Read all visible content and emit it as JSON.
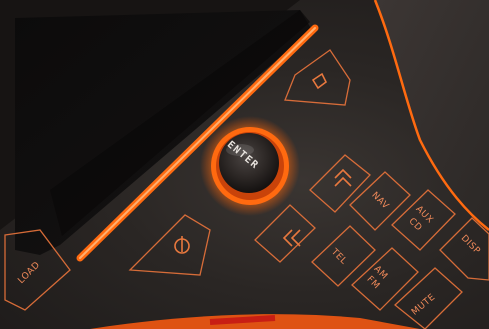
{
  "photo": {
    "subject": "car-audio-head-unit-panel",
    "accent_color": "#ff6a10",
    "label_color": "#f08a5a",
    "knob": {
      "label": "ENTER"
    },
    "buttons": [
      {
        "name": "load",
        "label": "LOAD"
      },
      {
        "name": "tel",
        "label": "TEL"
      },
      {
        "name": "nav",
        "label": "NAV"
      },
      {
        "name": "aux-cd-line1",
        "label": "AUX"
      },
      {
        "name": "aux-cd-line2",
        "label": "CD"
      },
      {
        "name": "am-fm-line1",
        "label": "AM"
      },
      {
        "name": "am-fm-line2",
        "label": "FM"
      },
      {
        "name": "mute",
        "label": "MUTE"
      },
      {
        "name": "disp",
        "label": "DISP"
      }
    ]
  }
}
